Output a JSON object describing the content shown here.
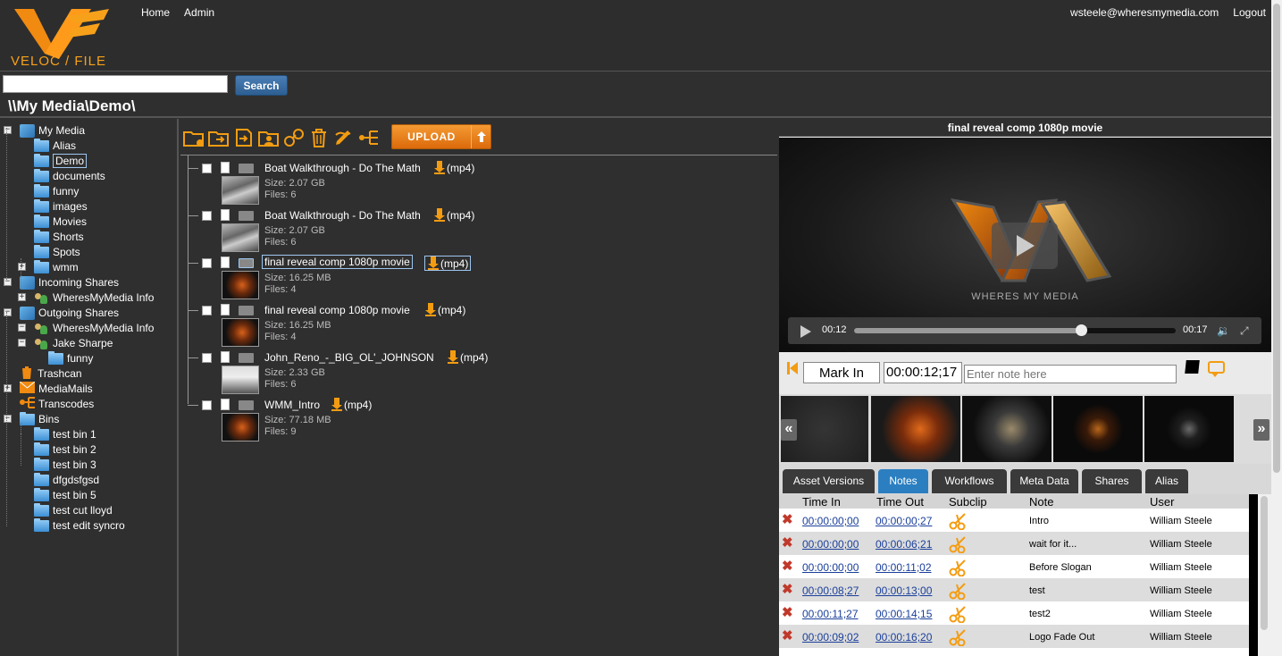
{
  "brand": {
    "logo_text": "VELOC / FILE"
  },
  "nav": {
    "home": "Home",
    "admin": "Admin"
  },
  "user": {
    "email": "wsteele@wheresmymedia.com",
    "logout": "Logout"
  },
  "search": {
    "value": "",
    "placeholder": "",
    "button": "Search"
  },
  "path": "\\\\My Media\\Demo\\",
  "tree": [
    {
      "label": "My Media",
      "icon": "my-media-icon"
    },
    {
      "label": "Alias",
      "icon": "folder-icon"
    },
    {
      "label": "Demo",
      "icon": "folder-icon",
      "selected": true
    },
    {
      "label": "documents",
      "icon": "folder-icon"
    },
    {
      "label": "funny",
      "icon": "folder-icon"
    },
    {
      "label": "images",
      "icon": "folder-icon"
    },
    {
      "label": "Movies",
      "icon": "folder-icon"
    },
    {
      "label": "Shorts",
      "icon": "folder-icon"
    },
    {
      "label": "Spots",
      "icon": "folder-icon"
    },
    {
      "label": "wmm",
      "icon": "folder-icon"
    },
    {
      "label": "Incoming Shares",
      "icon": "shares-icon"
    },
    {
      "label": "WheresMyMedia Info",
      "icon": "people-icon"
    },
    {
      "label": "Outgoing Shares",
      "icon": "shares-icon"
    },
    {
      "label": "WheresMyMedia Info",
      "icon": "people-icon"
    },
    {
      "label": "Jake Sharpe",
      "icon": "people-icon"
    },
    {
      "label": "funny",
      "icon": "folder-icon"
    },
    {
      "label": "Trashcan",
      "icon": "trashcan-icon"
    },
    {
      "label": "MediaMails",
      "icon": "mail-icon"
    },
    {
      "label": "Transcodes",
      "icon": "transcode-icon"
    },
    {
      "label": "Bins",
      "icon": "folder-icon"
    },
    {
      "label": "test bin 1",
      "icon": "folder-icon"
    },
    {
      "label": "test bin 2",
      "icon": "folder-icon"
    },
    {
      "label": "test bin 3",
      "icon": "folder-icon"
    },
    {
      "label": "dfgdsfgsd",
      "icon": "folder-icon"
    },
    {
      "label": "test bin 5",
      "icon": "folder-icon"
    },
    {
      "label": "test cut lloyd",
      "icon": "folder-icon"
    },
    {
      "label": "test edit syncro",
      "icon": "folder-icon"
    }
  ],
  "toolbar": {
    "upload": "UPLOAD"
  },
  "files": [
    {
      "name": "Boat Walkthrough - Do The Math",
      "format": "(mp4)",
      "size": "Size: 2.07 GB",
      "count": "Files: 6"
    },
    {
      "name": "Boat Walkthrough - Do The Math",
      "format": "(mp4)",
      "size": "Size: 2.07 GB",
      "count": "Files: 6"
    },
    {
      "name": "final reveal comp 1080p movie",
      "format": "(mp4)",
      "size": "Size: 16.25 MB",
      "count": "Files: 4"
    },
    {
      "name": "final reveal comp 1080p movie",
      "format": "(mp4)",
      "size": "Size: 16.25 MB",
      "count": "Files: 4"
    },
    {
      "name": "John_Reno_-_BIG_OL'_JOHNSON",
      "format": "(mp4)",
      "size": "Size: 2.33 GB",
      "count": "Files: 6"
    },
    {
      "name": "WMM_Intro",
      "format": "(mp4)",
      "size": "Size: 77.18 MB",
      "count": "Files: 9"
    }
  ],
  "player": {
    "title": "final reveal comp 1080p movie",
    "watermark": "WHERES MY MEDIA",
    "current": "00:12",
    "duration": "00:17",
    "progress": 0.706
  },
  "mark": {
    "button": "Mark In",
    "timecode": "00:00:12;17",
    "note_placeholder": "Enter note here"
  },
  "tabs": [
    "Asset Versions",
    "Notes",
    "Workflows",
    "Meta Data",
    "Shares",
    "Alias"
  ],
  "active_tab": "Notes",
  "notes": {
    "headers": [
      "Time In",
      "Time Out",
      "Subclip",
      "Note",
      "User"
    ],
    "rows": [
      {
        "in": "00:00:00;00",
        "out": "00:00:00;27",
        "note": "Intro",
        "user": "William Steele"
      },
      {
        "in": "00:00:00;00",
        "out": "00:00:06;21",
        "note": "wait for it...",
        "user": "William Steele"
      },
      {
        "in": "00:00:00;00",
        "out": "00:00:11;02",
        "note": "Before Slogan",
        "user": "William Steele"
      },
      {
        "in": "00:00:08;27",
        "out": "00:00:13;00",
        "note": "test",
        "user": "William Steele"
      },
      {
        "in": "00:00:11;27",
        "out": "00:00:14;15",
        "note": "test2",
        "user": "William Steele"
      },
      {
        "in": "00:00:09;02",
        "out": "00:00:16;20",
        "note": "Logo Fade Out",
        "user": "William Steele"
      }
    ]
  },
  "colors": {
    "accent": "#f39c12",
    "active_tab": "#2b7fc1",
    "link": "#1a3f9a"
  }
}
